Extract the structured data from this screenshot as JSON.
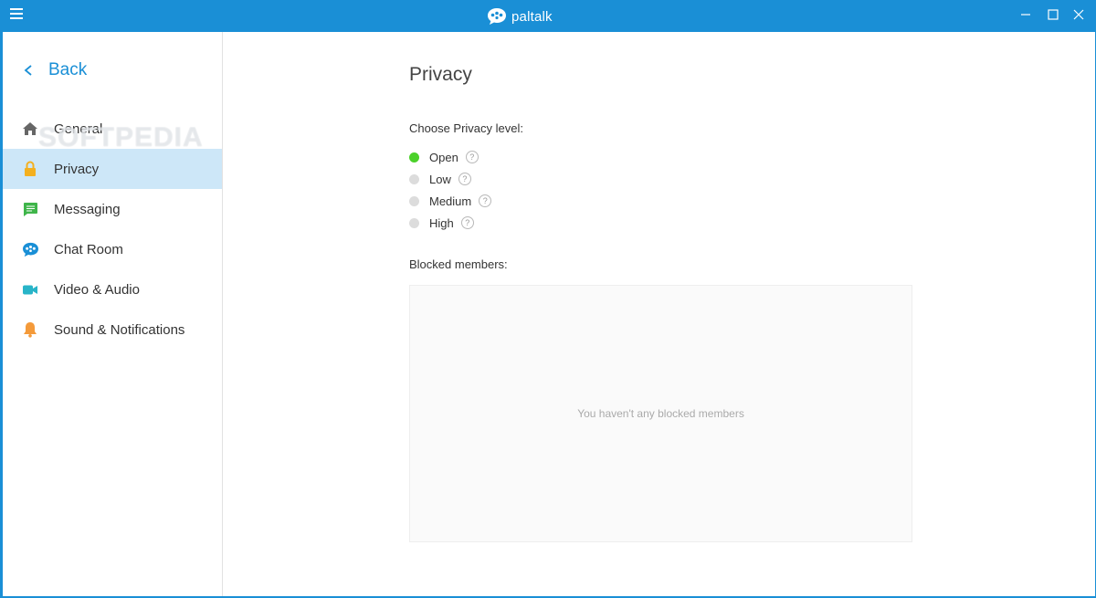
{
  "titlebar": {
    "app_name": "paltalk",
    "menu_icon": "hamburger-menu-icon",
    "minimize_icon": "minimize-icon",
    "maximize_icon": "maximize-icon",
    "close_icon": "close-icon"
  },
  "sidebar": {
    "back_label": "Back",
    "items": [
      {
        "label": "General",
        "icon": "home-icon",
        "color": "#666666"
      },
      {
        "label": "Privacy",
        "icon": "lock-icon",
        "color": "#f4b01f",
        "active": true
      },
      {
        "label": "Messaging",
        "icon": "message-icon",
        "color": "#3fb54a"
      },
      {
        "label": "Chat Room",
        "icon": "chat-room-icon",
        "color": "#1a8fd6"
      },
      {
        "label": "Video & Audio",
        "icon": "video-camera-icon",
        "color": "#28b4c8"
      },
      {
        "label": "Sound & Notifications",
        "icon": "bell-icon",
        "color": "#f49a3a"
      }
    ]
  },
  "watermark": "SOFTPEDIA",
  "main": {
    "title": "Privacy",
    "choose_label": "Choose Privacy level:",
    "options": [
      {
        "label": "Open",
        "selected": true
      },
      {
        "label": "Low",
        "selected": false
      },
      {
        "label": "Medium",
        "selected": false
      },
      {
        "label": "High",
        "selected": false
      }
    ],
    "help_glyph": "?",
    "blocked_label": "Blocked members:",
    "blocked_empty": "You haven't any blocked members"
  },
  "colors": {
    "accent": "#1a8fd6",
    "selected_radio": "#4bd12a",
    "active_nav_bg": "#cde7f8"
  }
}
